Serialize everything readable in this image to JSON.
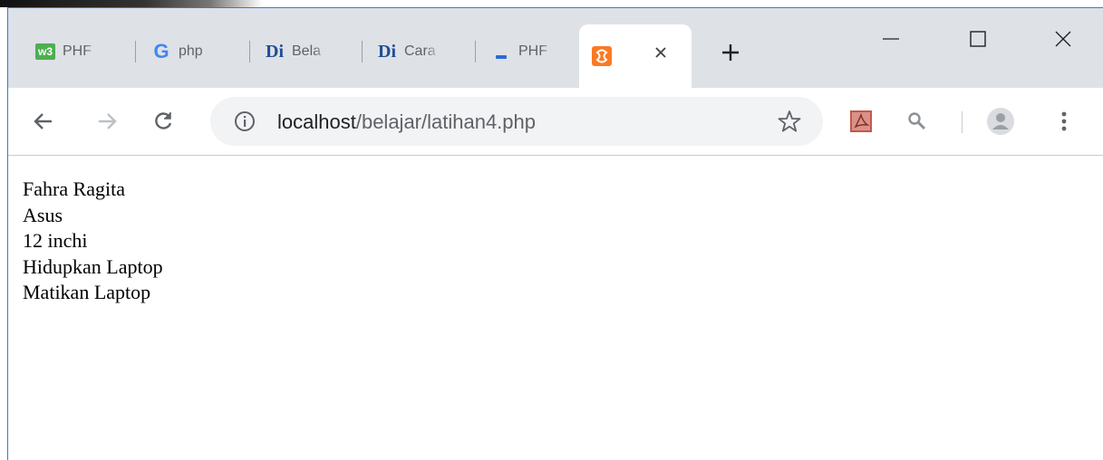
{
  "tabs": [
    {
      "label": "PHF",
      "favicon": "w3schools-icon",
      "favicon_color": "#4caf50"
    },
    {
      "label": "php",
      "favicon": "google-icon"
    },
    {
      "label": "Bela",
      "favicon": "dicoding-icon"
    },
    {
      "label": "Cara",
      "favicon": "dicoding-icon"
    },
    {
      "label": "PHF",
      "favicon": "php-dash-icon"
    },
    {
      "label": "",
      "favicon": "xampp-icon",
      "active": true,
      "favicon_color": "#fb7a24"
    }
  ],
  "favicon_texts": {
    "w3": "w3",
    "google": "G",
    "dicoding": "Di"
  },
  "address_bar": {
    "host": "localhost",
    "path": "/belajar/latihan4.php"
  },
  "page_lines": [
    "Fahra Ragita",
    "Asus",
    "12 inchi",
    "Hidupkan Laptop",
    "Matikan Laptop"
  ],
  "colors": {
    "tabstrip": "#dee1e6",
    "window_border": "#2f7fd0",
    "omnibox": "#f1f3f4",
    "pdf_icon": "#c6574a"
  }
}
